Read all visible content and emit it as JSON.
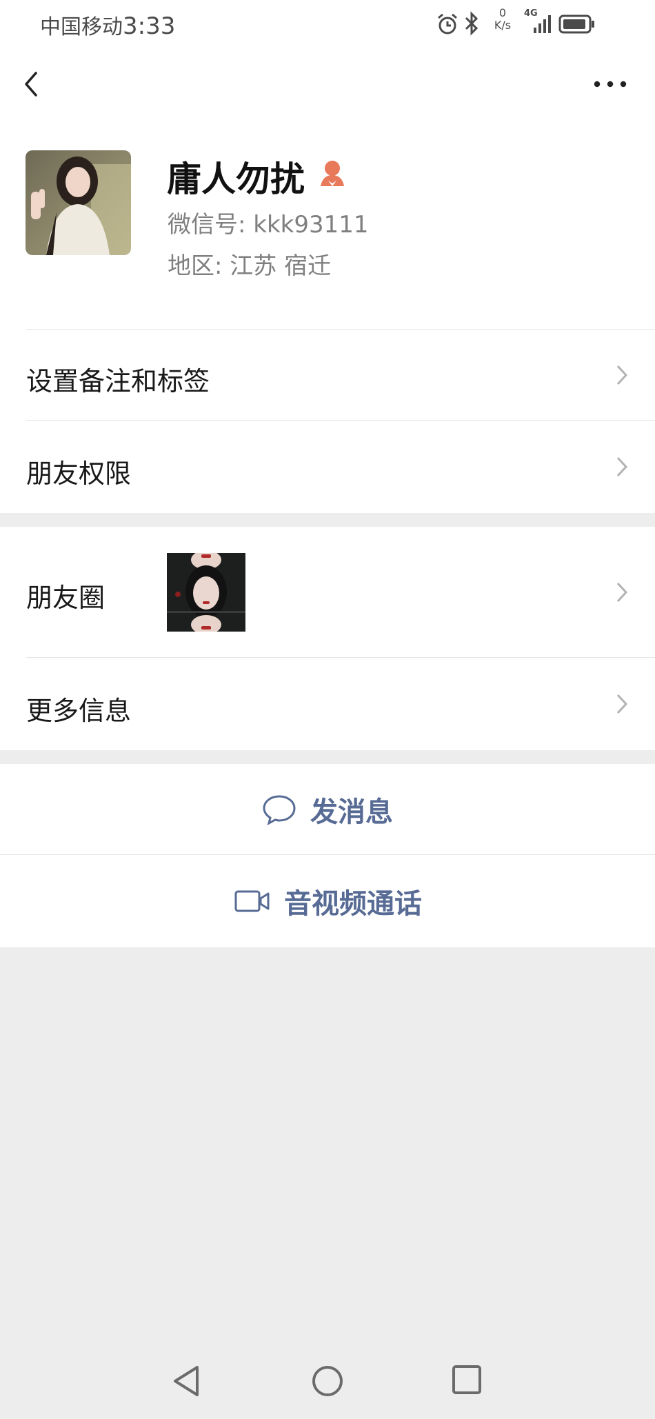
{
  "status_bar": {
    "carrier": "中国移动",
    "time": "3:33",
    "net_speed_value": "0",
    "net_speed_unit": "K/s",
    "network": "4G",
    "icons": [
      "alarm-icon",
      "bluetooth-icon",
      "signal-icon",
      "battery-icon"
    ]
  },
  "nav": {
    "back_icon": "chevron-left-icon",
    "more_icon": "more-dots-icon"
  },
  "profile": {
    "name": "庸人勿扰",
    "gender_icon": "female-icon",
    "wechat_id": "微信号:  kkk93111",
    "region": "地区:  江苏  宿迁"
  },
  "rows": {
    "remark_tags": "设置备注和标签",
    "friend_permissions": "朋友权限",
    "moments": "朋友圈",
    "more_info": "更多信息"
  },
  "actions": {
    "send_message": "发消息",
    "av_call": "音视频通话"
  },
  "colors": {
    "accent_link": "#576b95",
    "gender_icon": "#e8795a",
    "background": "#ededed"
  }
}
